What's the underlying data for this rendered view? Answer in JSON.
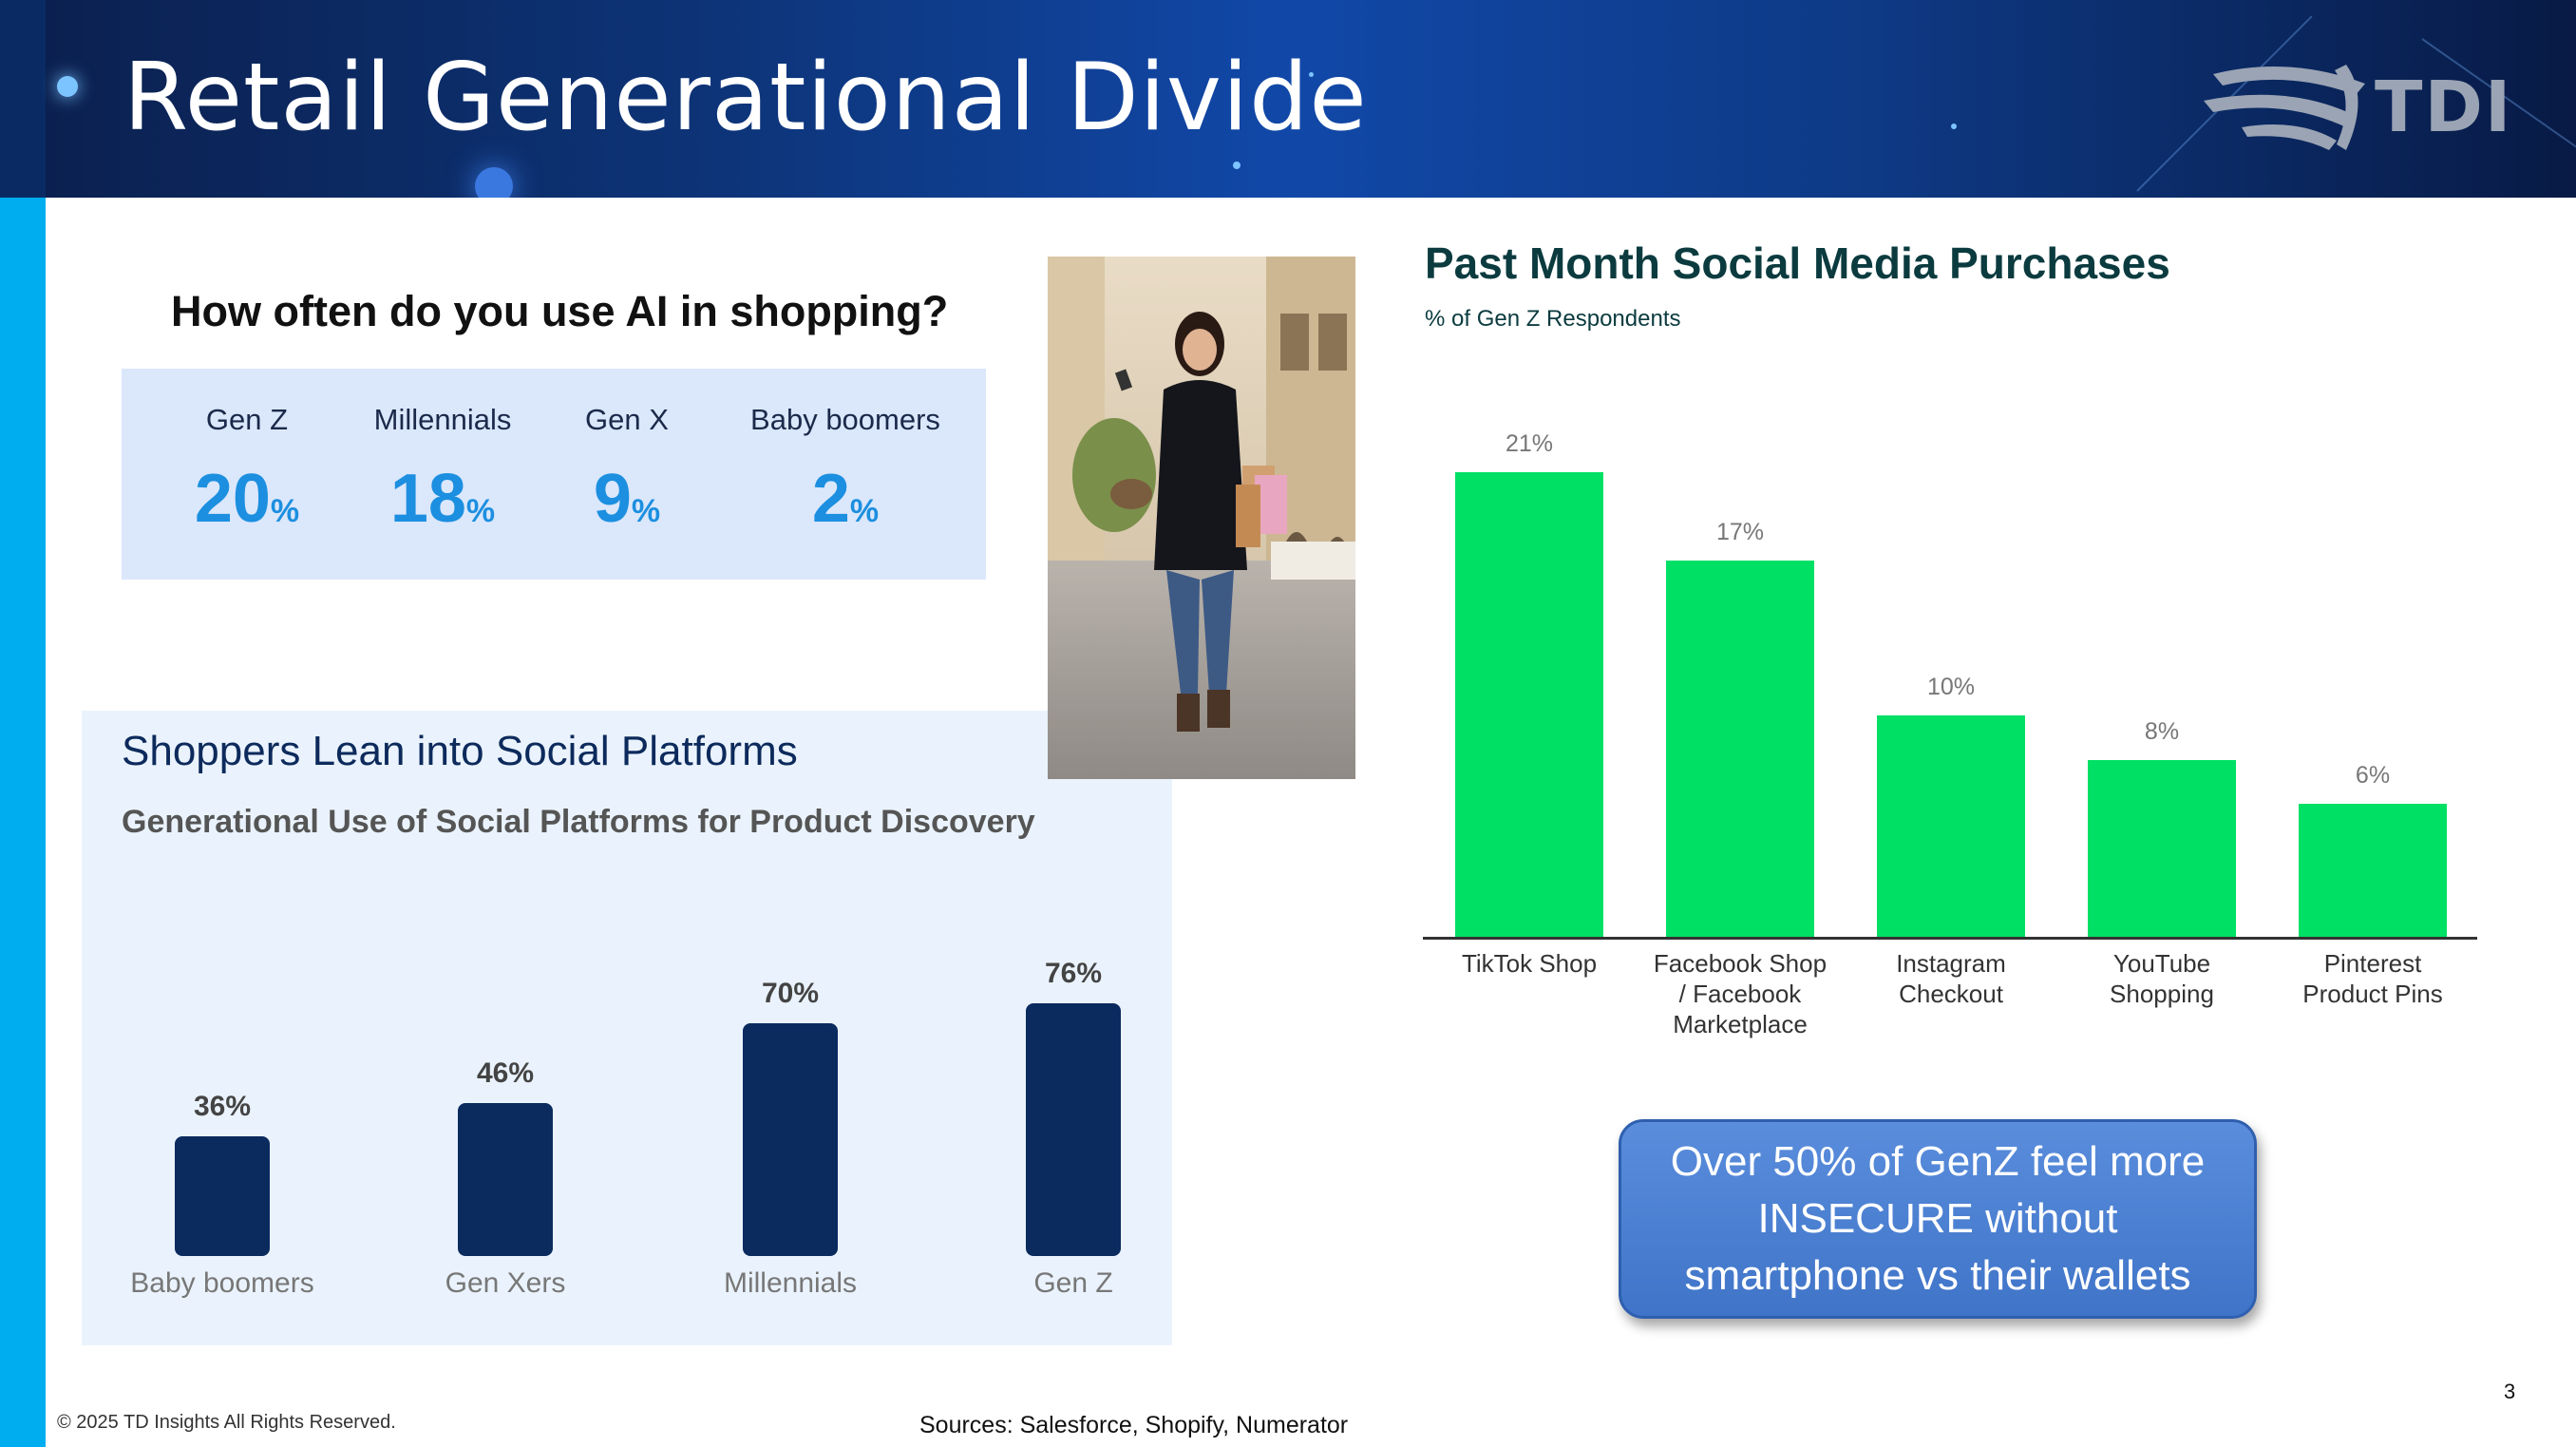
{
  "header": {
    "title": "Retail Generational Divide",
    "logo_text": "TDI"
  },
  "ai_usage": {
    "question": "How often do you use AI in shopping?",
    "items": [
      {
        "label": "Gen Z",
        "value": "20",
        "unit": "%"
      },
      {
        "label": "Millennials",
        "value": "18",
        "unit": "%"
      },
      {
        "label": "Gen X",
        "value": "9",
        "unit": "%"
      },
      {
        "label": "Baby boomers",
        "value": "2",
        "unit": "%"
      }
    ]
  },
  "shoppers": {
    "title": "Shoppers Lean into Social Platforms",
    "subtitle": "Generational Use of Social Platforms for Product Discovery"
  },
  "social_purchases": {
    "title": "Past Month Social Media Purchases",
    "subtitle": "% of Gen Z Respondents"
  },
  "chart_data": [
    {
      "type": "bar",
      "title": "Generational Use of Social Platforms for Product Discovery",
      "categories": [
        "Baby boomers",
        "Gen Xers",
        "Millennials",
        "Gen Z"
      ],
      "values": [
        36,
        46,
        70,
        76
      ],
      "value_labels": [
        "36%",
        "46%",
        "70%",
        "76%"
      ],
      "colors": [
        "#0b2a5e"
      ],
      "ylim": [
        0,
        100
      ]
    },
    {
      "type": "bar",
      "title": "Past Month Social Media Purchases",
      "subtitle": "% of Gen Z Respondents",
      "categories": [
        [
          "TikTok Shop"
        ],
        [
          "Facebook Shop",
          "/ Facebook",
          "Marketplace"
        ],
        [
          "Instagram",
          "Checkout"
        ],
        [
          "YouTube",
          "Shopping"
        ],
        [
          "Pinterest",
          "Product Pins"
        ]
      ],
      "values": [
        21,
        17,
        10,
        8,
        6
      ],
      "value_labels": [
        "21%",
        "17%",
        "10%",
        "8%",
        "6%"
      ],
      "colors": [
        "#00e065"
      ],
      "ylim": [
        0,
        22
      ]
    }
  ],
  "callout": {
    "lines": [
      "Over 50% of GenZ feel more",
      "INSECURE without",
      "smartphone vs their wallets"
    ]
  },
  "footer": {
    "copyright": "© 2025 TD Insights All Rights Reserved.",
    "sources": "Sources: Salesforce, Shopify, Numerator",
    "page_number": "3"
  },
  "colors": {
    "header_blue": "#0d3478",
    "sidebar_cyan": "#00aeef",
    "ai_panel_bg": "#dbe7fb",
    "ai_value_blue": "#1c8fe0",
    "navy_bar": "#0b2a5e",
    "green_bar": "#00e065",
    "callout_blue": "#4a7fd0"
  }
}
